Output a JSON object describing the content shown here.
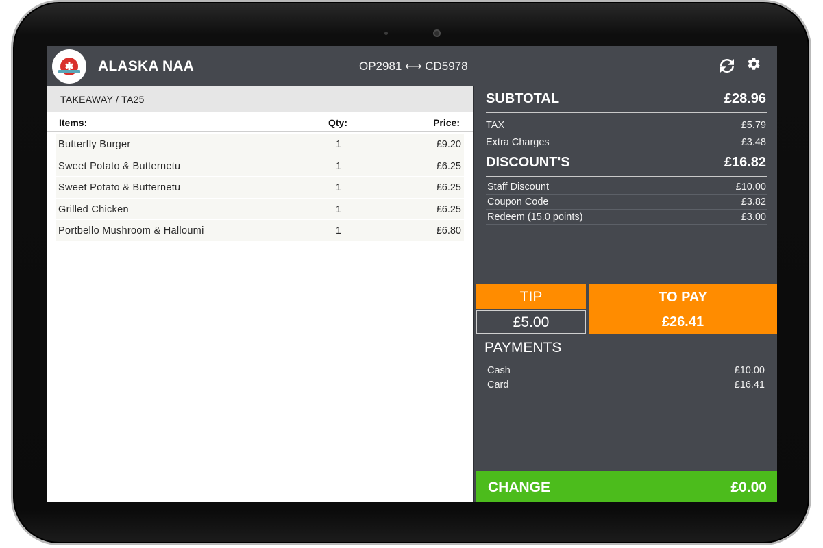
{
  "header": {
    "logo_text": "✱",
    "title": "ALASKA NAA",
    "op_codes": "OP2981 ⟷ CD5978",
    "refresh_icon": "refresh-icon",
    "settings_icon": "gear-icon"
  },
  "order": {
    "label": "TAKEAWAY / TA25",
    "columns": {
      "items": "Items:",
      "qty": "Qty:",
      "price": "Price:"
    },
    "rows": [
      {
        "name": "Butterfly Burger",
        "qty": "1",
        "price": "£9.20"
      },
      {
        "name": "Sweet Potato & Butternetu",
        "qty": "1",
        "price": "£6.25"
      },
      {
        "name": "Sweet Potato & Butternetu",
        "qty": "1",
        "price": "£6.25"
      },
      {
        "name": "Grilled Chicken",
        "qty": "1",
        "price": "£6.25"
      },
      {
        "name": "Portbello Mushroom & Halloumi",
        "qty": "1",
        "price": "£6.80"
      }
    ]
  },
  "summary": {
    "subtotal_label": "SUBTOTAL",
    "subtotal_value": "£28.96",
    "tax_label": "TAX",
    "tax_value": "£5.79",
    "extra_label": "Extra Charges",
    "extra_value": "£3.48",
    "discount_label": "DISCOUNT'S",
    "discount_value": "£16.82",
    "discounts": [
      {
        "label": "Staff Discount",
        "value": "£10.00"
      },
      {
        "label": "Coupon Code",
        "value": "£3.82"
      },
      {
        "label": "Redeem (15.0 points)",
        "value": "£3.00"
      }
    ],
    "tip_label": "TIP",
    "tip_value": "£5.00",
    "topay_label": "TO PAY",
    "topay_value": "£26.41",
    "payments_title": "PAYMENTS",
    "payments": [
      {
        "label": "Cash",
        "value": "£10.00"
      },
      {
        "label": "Card",
        "value": "£16.41"
      }
    ],
    "change_label": "CHANGE",
    "change_value": "£0.00"
  },
  "colors": {
    "header_bg": "#45484e",
    "accent_orange": "#ff8c00",
    "change_green": "#4cbc1c",
    "logo_red": "#d9302c"
  }
}
